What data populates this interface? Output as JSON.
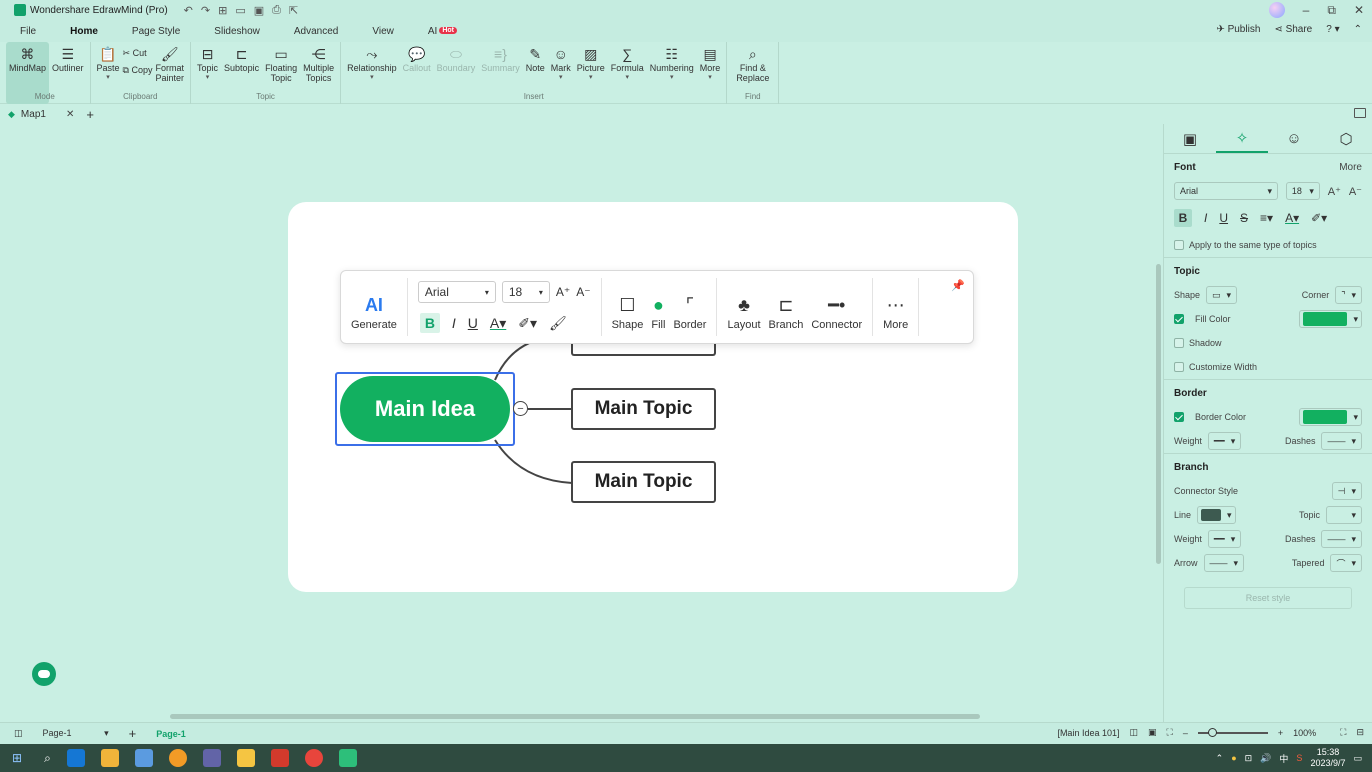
{
  "app": {
    "title": "Wondershare EdrawMind (Pro)"
  },
  "menu": {
    "tabs": [
      "File",
      "Home",
      "Page Style",
      "Slideshow",
      "Advanced",
      "View",
      "AI"
    ],
    "hot_badge": "Hot",
    "publish": "Publish",
    "share": "Share"
  },
  "ribbon": {
    "mode": {
      "label": "Mode",
      "mindmap": "MindMap",
      "outliner": "Outliner"
    },
    "clipboard": {
      "label": "Clipboard",
      "paste": "Paste",
      "cut": "Cut",
      "copy": "Copy",
      "format_painter_1": "Format",
      "format_painter_2": "Painter"
    },
    "topic": {
      "label": "Topic",
      "topic": "Topic",
      "subtopic": "Subtopic",
      "floating_1": "Floating",
      "floating_2": "Topic",
      "multiple_1": "Multiple",
      "multiple_2": "Topics"
    },
    "insert": {
      "label": "Insert",
      "relationship": "Relationship",
      "callout": "Callout",
      "boundary": "Boundary",
      "summary": "Summary",
      "note": "Note",
      "mark": "Mark",
      "picture": "Picture",
      "formula": "Formula",
      "numbering": "Numbering",
      "more": "More"
    },
    "find": {
      "label": "Find",
      "find_1": "Find &",
      "find_2": "Replace"
    }
  },
  "doc_tab": {
    "name": "Map1"
  },
  "floating_toolbar": {
    "generate": "Generate",
    "ai": "AI",
    "font": "Arial",
    "size": "18",
    "shape": "Shape",
    "fill": "Fill",
    "border": "Border",
    "layout": "Layout",
    "branch": "Branch",
    "connector": "Connector",
    "more": "More"
  },
  "mindmap": {
    "main_idea": "Main Idea",
    "topics": [
      "Main Topic",
      "Main Topic"
    ]
  },
  "panel": {
    "font": {
      "title": "Font",
      "more": "More",
      "family": "Arial",
      "size": "18",
      "apply_same": "Apply to the same type of topics"
    },
    "topic": {
      "title": "Topic",
      "shape": "Shape",
      "corner": "Corner",
      "fill_color": "Fill Color",
      "shadow": "Shadow",
      "customize_width": "Customize Width"
    },
    "border": {
      "title": "Border",
      "border_color": "Border Color",
      "weight": "Weight",
      "dashes": "Dashes"
    },
    "branch": {
      "title": "Branch",
      "connector_style": "Connector Style",
      "line": "Line",
      "topic": "Topic",
      "weight": "Weight",
      "dashes": "Dashes",
      "arrow": "Arrow",
      "tapered": "Tapered"
    },
    "reset": "Reset style"
  },
  "status": {
    "page_select": "Page-1",
    "page_tab": "Page-1",
    "selection": "[Main Idea 101]",
    "zoom": "100%"
  },
  "taskbar": {
    "time": "15:38",
    "date": "2023/9/7"
  },
  "colors": {
    "accent": "#12a26b",
    "main_idea_fill": "#12b060",
    "selection": "#3b6fe8",
    "line_color": "#3d5a50"
  }
}
